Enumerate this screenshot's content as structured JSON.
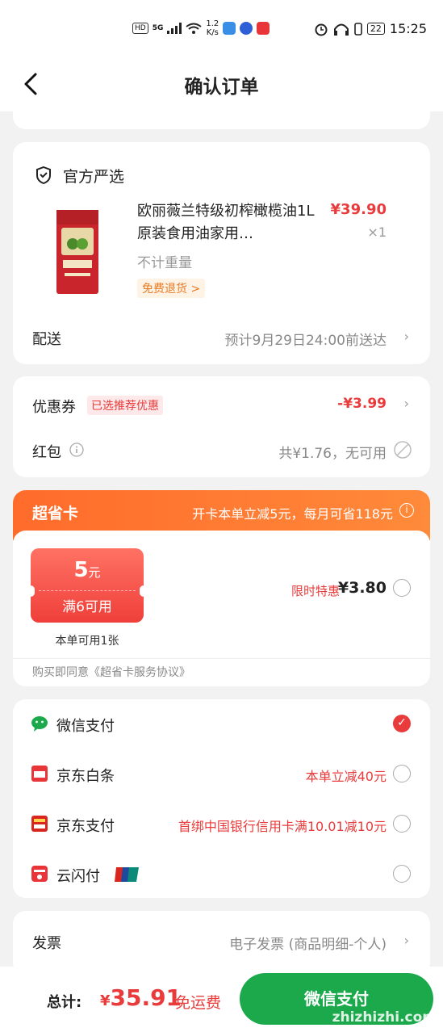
{
  "status_bar": {
    "hd": "HD",
    "network": "5G",
    "speed_value": "1.2",
    "speed_unit": "K/s",
    "battery": "22",
    "time": "15:25"
  },
  "nav": {
    "title": "确认订单"
  },
  "product_card": {
    "shop_name": "官方严选",
    "product_title": "欧丽薇兰特级初榨橄榄油1L原装食用油家用…",
    "price": "¥39.90",
    "quantity": "×1",
    "weight": "不计重量",
    "refund_tag": "免费退货 >",
    "delivery_label": "配送",
    "delivery_value": "预计9月29日24:00前送达"
  },
  "discount_card": {
    "coupon_label": "优惠券",
    "coupon_tag": "已选推荐优惠",
    "coupon_value": "-¥3.99",
    "redpacket_label": "红包",
    "redpacket_value": "共¥1.76，无可用"
  },
  "super_card": {
    "title": "超省卡",
    "desc": "开卡本单立减5元，每月可省118元",
    "coupon_amount": "5",
    "coupon_unit": "元",
    "coupon_condition": "满6可用",
    "coupon_count": "本单可用1张",
    "promo_tag": "限时特惠",
    "price": "¥3.80",
    "agreement": "购买即同意《超省卡服务协议》"
  },
  "payment": {
    "methods": [
      {
        "label": "微信支付",
        "promo": "",
        "checked": true
      },
      {
        "label": "京东白条",
        "promo": "本单立减40元",
        "checked": false
      },
      {
        "label": "京东支付",
        "promo": "首绑中国银行信用卡满10.01减10元",
        "checked": false
      },
      {
        "label": "云闪付",
        "promo": "",
        "checked": false
      }
    ]
  },
  "invoice": {
    "label": "发票",
    "value": "电子发票 (商品明细-个人)"
  },
  "bottom_bar": {
    "total_label": "总计:",
    "currency": "¥",
    "total_amount": "35.91",
    "free_shipping": "免运费",
    "pay_button": "微信支付",
    "watermark": "zhizhizhi.com"
  },
  "colors": {
    "accent_red": "#e93b3b",
    "wechat_green": "#1ba94c",
    "super_card_orange": "#ff6b2b"
  }
}
